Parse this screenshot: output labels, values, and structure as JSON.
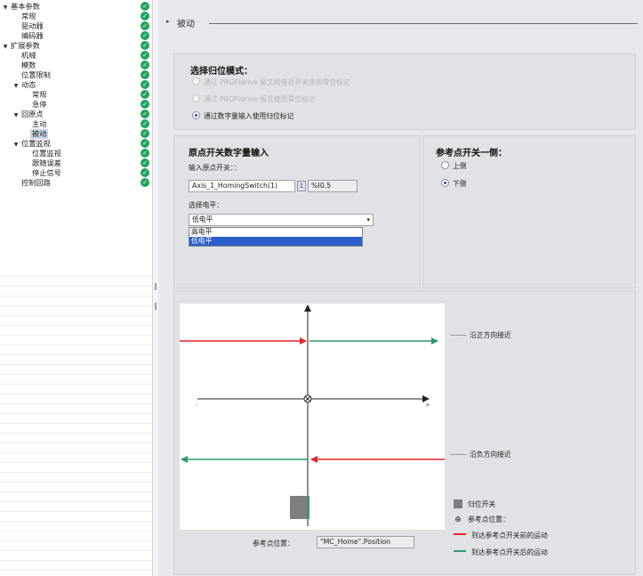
{
  "tree": {
    "items": [
      {
        "label": "基本参数",
        "level": 0,
        "toggle": "down",
        "selected": false
      },
      {
        "label": "常规",
        "level": 1,
        "toggle": "",
        "selected": false
      },
      {
        "label": "驱动器",
        "level": 1,
        "toggle": "",
        "selected": false
      },
      {
        "label": "编码器",
        "level": 1,
        "toggle": "",
        "selected": false
      },
      {
        "label": "扩展参数",
        "level": 0,
        "toggle": "down",
        "selected": false
      },
      {
        "label": "机械",
        "level": 1,
        "toggle": "",
        "selected": false
      },
      {
        "label": "模数",
        "level": 1,
        "toggle": "",
        "selected": false
      },
      {
        "label": "位置限制",
        "level": 1,
        "toggle": "",
        "selected": false
      },
      {
        "label": "动态",
        "level": 1,
        "toggle": "down",
        "selected": false
      },
      {
        "label": "常规",
        "level": 2,
        "toggle": "",
        "selected": false
      },
      {
        "label": "急停",
        "level": 2,
        "toggle": "",
        "selected": false
      },
      {
        "label": "回原点",
        "level": 1,
        "toggle": "down",
        "selected": false
      },
      {
        "label": "主动",
        "level": 2,
        "toggle": "",
        "selected": false
      },
      {
        "label": "被动",
        "level": 2,
        "toggle": "",
        "selected": true
      },
      {
        "label": "位置监视",
        "level": 1,
        "toggle": "down",
        "selected": false
      },
      {
        "label": "位置监视",
        "level": 2,
        "toggle": "",
        "selected": false
      },
      {
        "label": "跟随误差",
        "level": 2,
        "toggle": "",
        "selected": false
      },
      {
        "label": "停止信号",
        "level": 2,
        "toggle": "",
        "selected": false
      },
      {
        "label": "控制回路",
        "level": 1,
        "toggle": "",
        "selected": false
      }
    ],
    "status_color": "#21a35b",
    "status_icon": "check-circle-icon"
  },
  "section": {
    "title": "被动"
  },
  "mode": {
    "title": "选择归位模式：",
    "options": [
      {
        "label": "通过 PROFIdrive 报文和接近开关使用零位标记",
        "enabled": false,
        "checked": false
      },
      {
        "label": "通过 PROFIdrive 报文使用零位标记",
        "enabled": false,
        "checked": false
      },
      {
        "label": "通过数字量输入使用归位标记",
        "enabled": true,
        "checked": true
      }
    ]
  },
  "switch_input": {
    "title": "原点开关数字量输入",
    "input_label": "输入原点开关：：",
    "input_value": "Axis_1_HomingSwitch(1)",
    "browse_label": "1",
    "address_value": "%I0.5",
    "level_label": "选择电平：",
    "level_value": "低电平",
    "options": [
      {
        "label": "高电平",
        "selected": false
      },
      {
        "label": "低电平",
        "selected": true
      }
    ]
  },
  "side": {
    "title": "参考点开关一侧：",
    "options": [
      {
        "label": "上侧",
        "checked": false
      },
      {
        "label": "下侧",
        "checked": true
      }
    ]
  },
  "diagram": {
    "positive_label": "沿正方向接近",
    "negative_label": "沿负方向接近",
    "ref_position_label": "参考点位置：",
    "ref_position_value": "\"MC_Home\".Position",
    "legend": [
      {
        "label": "归位开关",
        "icon": "homing-switch-icon"
      },
      {
        "label": "参考点位置：",
        "icon": "reference-point-icon"
      },
      {
        "label": "到达参考点开关前的运动",
        "icon": "red-line-icon"
      },
      {
        "label": "到达参考点开关后的运动",
        "icon": "green-line-icon"
      }
    ],
    "colors": {
      "before": "#e8232a",
      "after": "#2e9a6a",
      "switch": "#7c7e80"
    }
  }
}
